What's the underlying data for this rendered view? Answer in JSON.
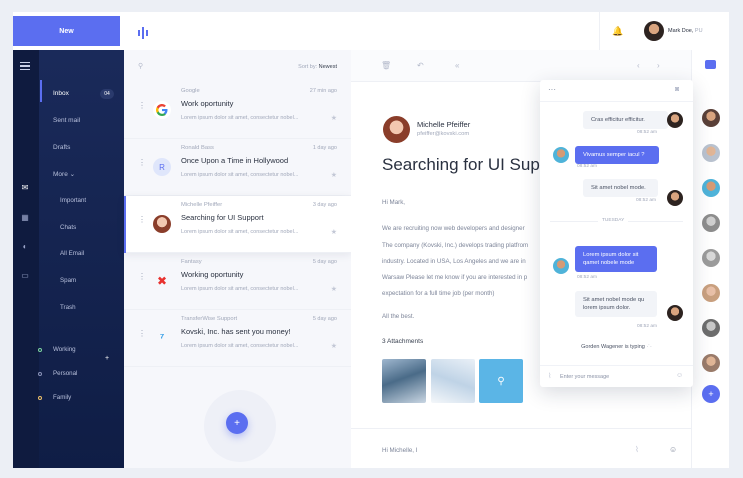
{
  "sidebar": {
    "new_label": "New",
    "items": [
      {
        "label": "Inbox",
        "badge": "04"
      },
      {
        "label": "Sent mail"
      },
      {
        "label": "Drafts"
      },
      {
        "label": "More"
      }
    ],
    "sub_items": [
      "Important",
      "Chats",
      "All Email",
      "Spam",
      "Trash"
    ],
    "labels": [
      {
        "label": "Working",
        "color": "#7dd3a0"
      },
      {
        "label": "Personal",
        "color": "#8a93b8"
      },
      {
        "label": "Family",
        "color": "#f1c26a"
      }
    ]
  },
  "list": {
    "sort_label": "Sort by:",
    "sort_value": "Newest",
    "mails": [
      {
        "from": "Google",
        "date": "27 min ago",
        "subject": "Work oportunity",
        "preview": "Lorem ipsum dolor sit amet, consectetur nobel..."
      },
      {
        "from": "Ronald Bass",
        "date": "1 day ago",
        "subject": "Once Upon a Time in Hollywood",
        "preview": "Lorem ipsum dolor sit amet, consectetur nobel...",
        "initial": "R"
      },
      {
        "from": "Michelle Pfeiffer",
        "date": "3 day ago",
        "subject": "Searching for UI Support",
        "preview": "Lorem ipsum dolor sit amet, consectetur nobel..."
      },
      {
        "from": "Fantasy",
        "date": "5 day ago",
        "subject": "Working oportunity",
        "preview": "Lorem ipsum dolor sit amet, consectetur nobel..."
      },
      {
        "from": "TransferWise Support",
        "date": "5 day ago",
        "subject": "Kovski, Inc. has sent you money!",
        "preview": "Lorem ipsum dolor sit amet, consectetur nobel..."
      }
    ]
  },
  "reader": {
    "sender_name": "Michelle Pfeiffer",
    "sender_email": "pfeiffer@kovski.com",
    "subject": "Searching for UI Sup",
    "greeting": "Hi Mark,",
    "lines": [
      "We are recruiting now web developers and designer",
      "The company (Kovski, Inc.) develops trading platfrom",
      "industry. Located in USA, Los Angeles and we are in",
      "Warsaw Please let me know if you are interested in p",
      "expectation for a full time job (per month)"
    ],
    "closing": "All the best.",
    "attachments_label": "3 Attachments",
    "reply_text": "Hi Michelle, I"
  },
  "user": {
    "name": "Mark Doe,",
    "suffix": "PU"
  },
  "chat": {
    "messages": [
      {
        "text": "Cras efficitur efficitur.",
        "time": "08:52 am"
      },
      {
        "text": "Vivamus semper iacul ?",
        "time": "08:52 am"
      },
      {
        "text": "Sit amet nobel mode.",
        "time": "08:52 am"
      },
      {
        "text": "Lorem ipsum dolor sit qamet nobele mode",
        "time": "08:52 am"
      },
      {
        "text": "Sit amet nobel mode qu lorem ipsum dolor.",
        "time": "08:52 am"
      }
    ],
    "divider": "TUESDAY",
    "typing": "Gorden Wagener is typing",
    "placeholder": "Enter your message"
  },
  "colors": {
    "accent": "#5b6ef0",
    "sidebar": "#13234f"
  }
}
